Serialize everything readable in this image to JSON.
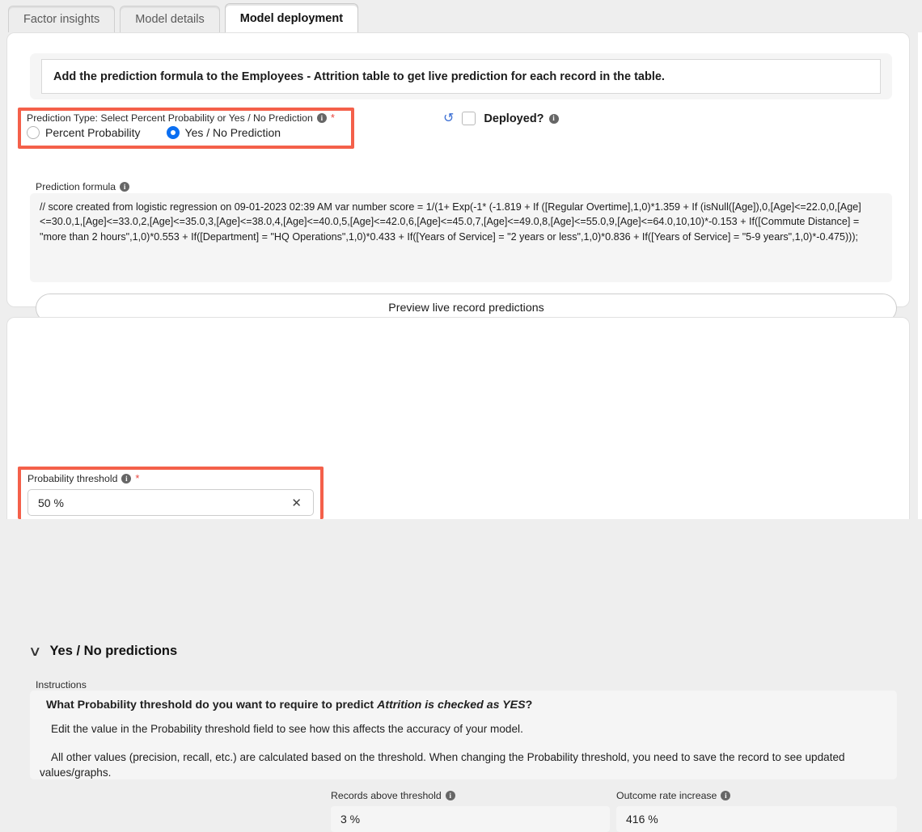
{
  "tabs": [
    {
      "label": "Factor insights",
      "active": false
    },
    {
      "label": "Model details",
      "active": false
    },
    {
      "label": "Model deployment",
      "active": true
    }
  ],
  "banner": {
    "text": "Add the prediction formula to the Employees - Attrition table to get live prediction for each record in the table."
  },
  "prediction_type": {
    "label": "Prediction Type: Select Percent Probability or Yes / No Prediction",
    "required_marker": "*",
    "info_glyph": "i",
    "options": [
      {
        "label": "Percent Probability",
        "selected": false
      },
      {
        "label": "Yes / No Prediction",
        "selected": true
      }
    ]
  },
  "deployed": {
    "label": "Deployed?",
    "checked": false,
    "undo_glyph": "↺"
  },
  "formula": {
    "label": "Prediction formula",
    "text": "// score created from logistic regression on 09-01-2023 02:39 AM\nvar number score = 1/(1+ Exp(-1* (-1.819 + If ([Regular Overtime],1,0)*1.359  +  If (isNull([Age]),0,[Age]<=22.0,0,[Age]<=30.0,1,[Age]<=33.0,2,[Age]<=35.0,3,[Age]<=38.0,4,[Age]<=40.0,5,[Age]<=42.0,6,[Age]<=45.0,7,[Age]<=49.0,8,[Age]<=55.0,9,[Age]<=64.0,10,10)*-0.153  +  If([Commute Distance] = \"more than 2 hours\",1,0)*0.553  +  If([Department] = \"HQ Operations\",1,0)*0.433  +  If([Years of Service] = \"2 years or less\",1,0)*0.836  +  If([Years of Service] = \"5-9 years\",1,0)*-0.475)));"
  },
  "preview_button": {
    "label": "Preview live record predictions"
  },
  "section": {
    "title": "Yes / No predictions",
    "collapse_glyph": "∨",
    "expanded": true
  },
  "instructions": {
    "label": "Instructions",
    "question_prefix": "What Probability threshold do you want to require to predict ",
    "question_emphasis": "Attrition is checked as YES",
    "question_suffix": "?",
    "paragraph_1": "Edit the value in the Probability threshold field to see how this affects the accuracy of your model.",
    "paragraph_2": "All other values (precision, recall, etc.) are calculated based on the threshold. When changing the Probability threshold, you need to save the record to see updated",
    "paragraph_2_cont": "values/graphs."
  },
  "metrics": {
    "probability_threshold": {
      "label": "Probability threshold",
      "required_marker": "*",
      "value": "50 %",
      "clear_glyph": "✕",
      "editable": true
    },
    "records_above_threshold": {
      "label": "Records above threshold",
      "value": "3 %",
      "editable": false
    },
    "outcome_rate_increase": {
      "label": "Outcome rate increase",
      "value": "416 %",
      "editable": false
    }
  },
  "colors": {
    "highlight": "#f4604a",
    "accent_radio": "#0b6ff2",
    "required": "#e8473f",
    "page_bg": "#eeeeee"
  }
}
